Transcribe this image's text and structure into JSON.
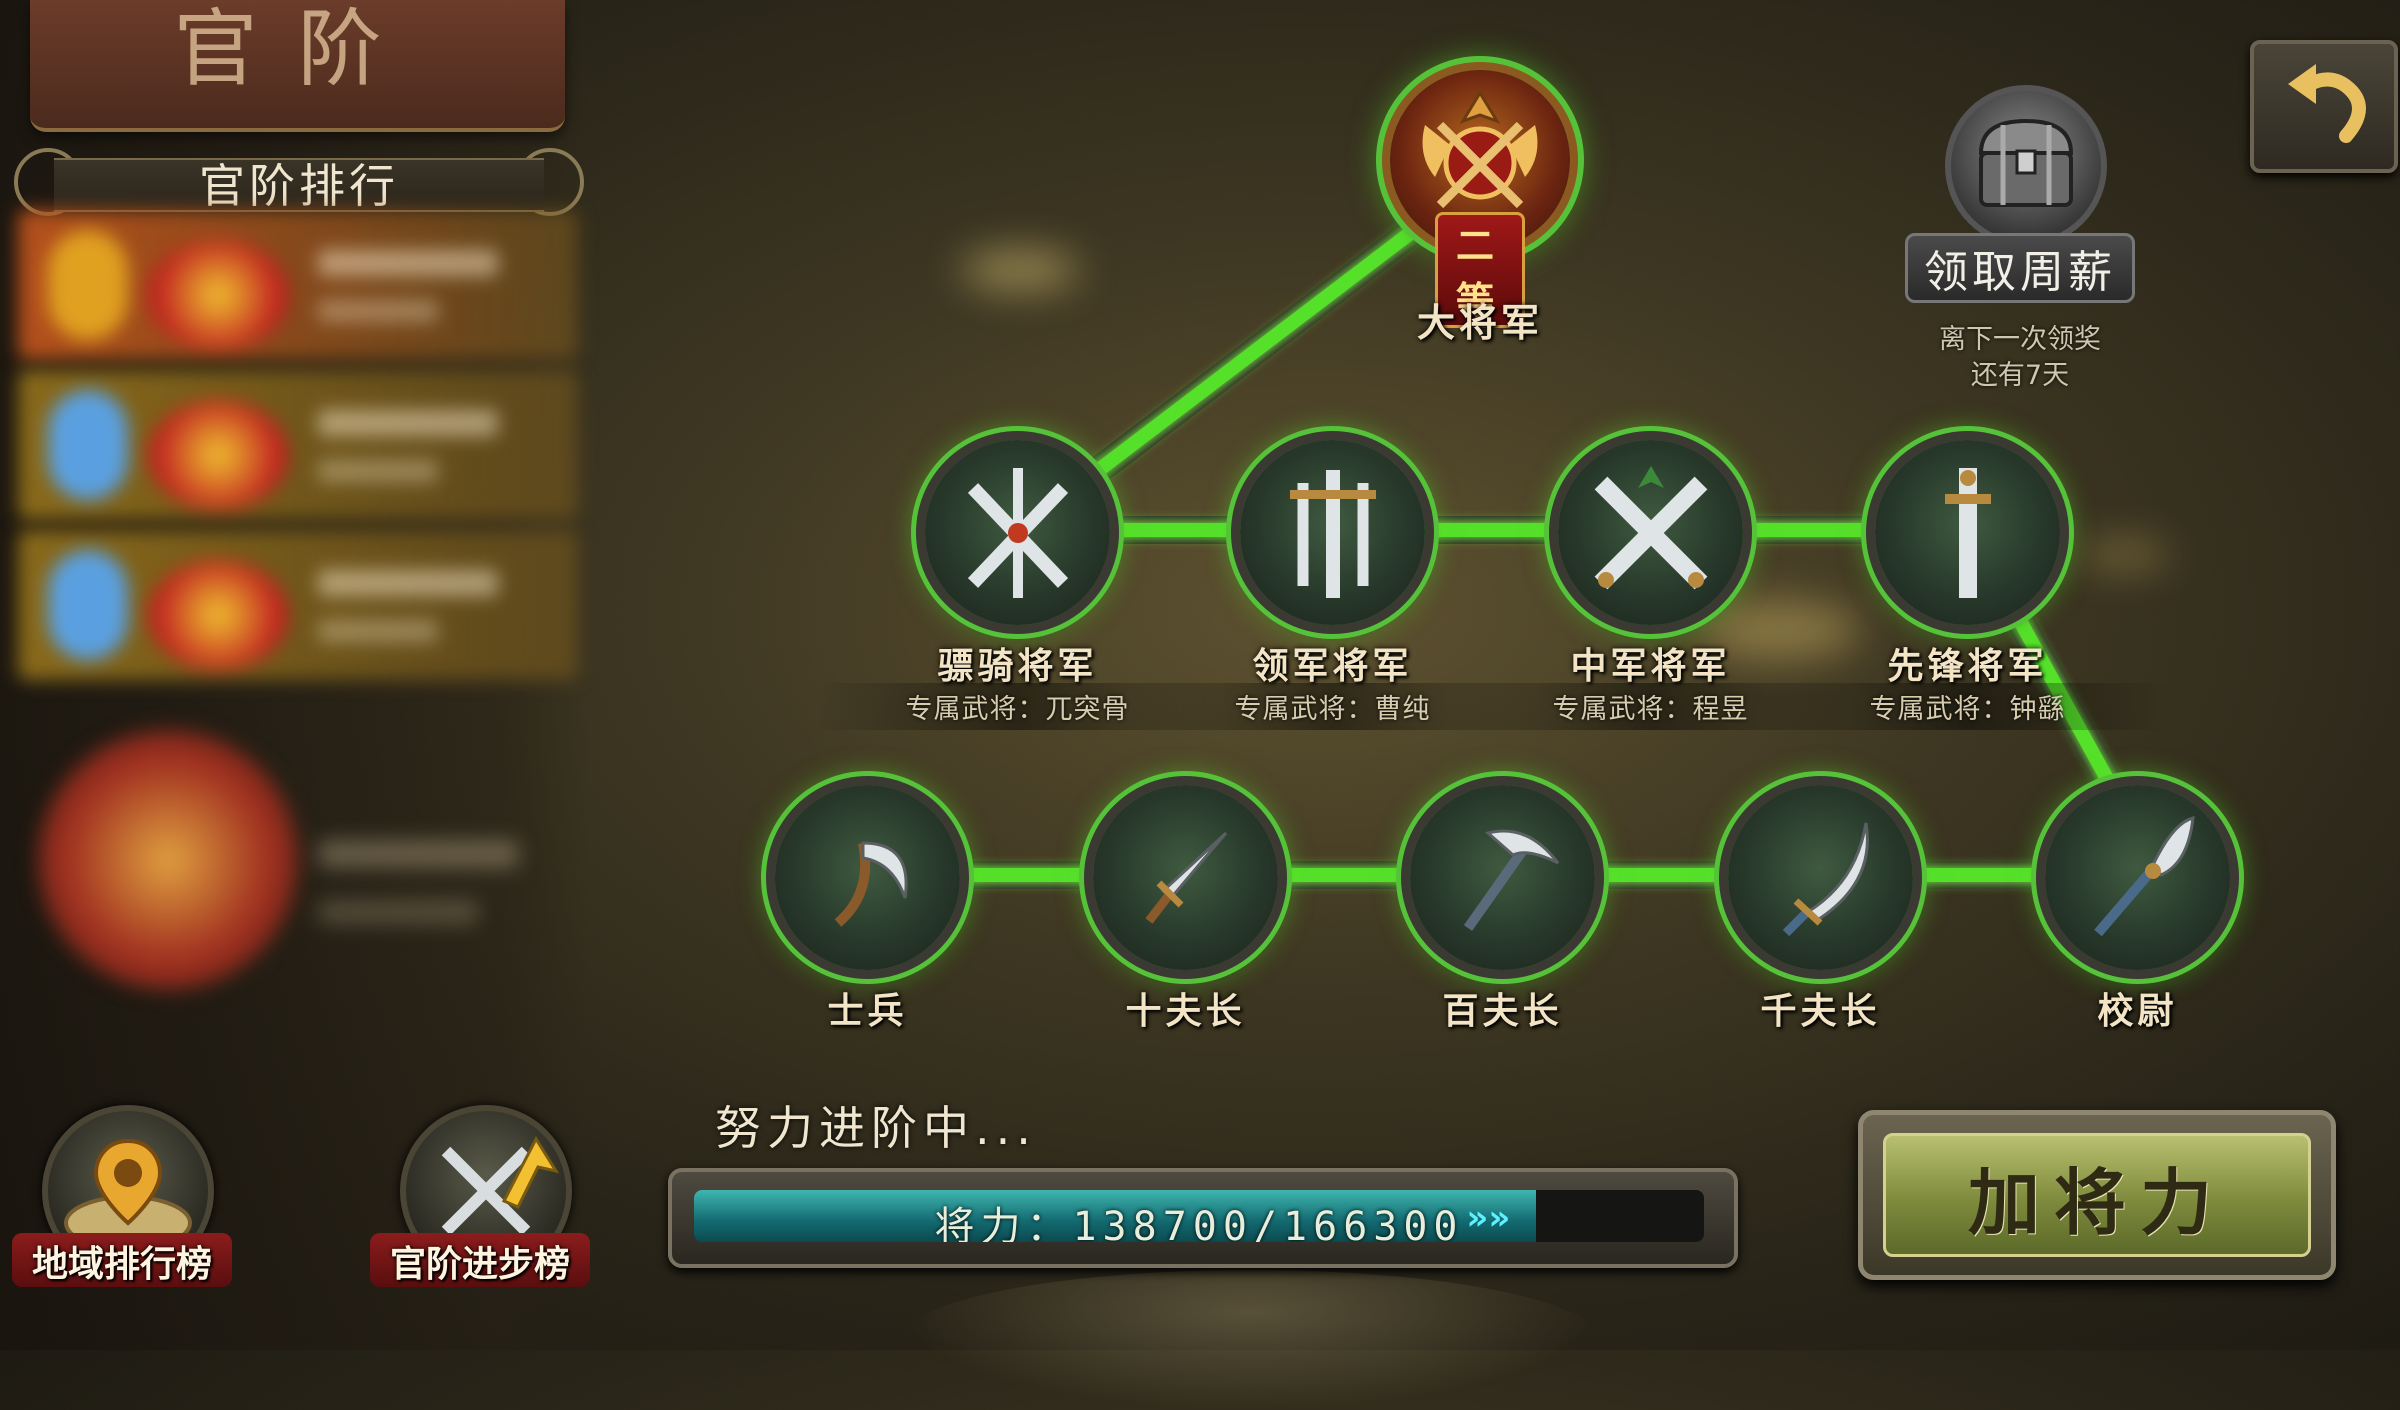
{
  "header": {
    "title": "官阶"
  },
  "ranking": {
    "title": "官阶排行",
    "rows": [
      {
        "color": "#b5501c"
      },
      {
        "color": "#8a6a1a"
      },
      {
        "color": "#8a6a1a"
      }
    ]
  },
  "bottom_left": {
    "region_board": "地域排行榜",
    "progress_board": "官阶进步榜"
  },
  "ranks": {
    "top": {
      "name": "大将军",
      "grade": "二等",
      "icon": "crossed-axes-crest-icon"
    },
    "middle": [
      {
        "name": "骠骑将军",
        "sub": "专属武将：兀突骨",
        "icon": "crossed-swords-icon"
      },
      {
        "name": "领军将军",
        "sub": "专属武将：曹纯",
        "icon": "triple-swords-icon"
      },
      {
        "name": "中军将军",
        "sub": "专属武将：程昱",
        "icon": "x-swords-icon"
      },
      {
        "name": "先锋将军",
        "sub": "专属武将：钟繇",
        "icon": "single-sword-icon"
      }
    ],
    "bottom": [
      {
        "name": "士兵",
        "icon": "sickle-icon"
      },
      {
        "name": "十夫长",
        "icon": "dagger-icon"
      },
      {
        "name": "百夫长",
        "icon": "pickaxe-icon"
      },
      {
        "name": "千夫长",
        "icon": "scimitar-icon"
      },
      {
        "name": "校尉",
        "icon": "glaive-icon"
      }
    ]
  },
  "weekly": {
    "label": "领取周薪",
    "note_line1": "离下一次领奖",
    "note_line2": "还有7天",
    "icon": "treasure-chest-icon"
  },
  "progress": {
    "label": "努力进阶中...",
    "text": "将力：138700/166300",
    "current": 138700,
    "max": 166300,
    "arrows": "»»"
  },
  "actions": {
    "add_power": "加将力"
  },
  "colors": {
    "path_green": "#55e02a",
    "gold": "#f2e4c4",
    "progress_teal": "#3fb6b0"
  }
}
